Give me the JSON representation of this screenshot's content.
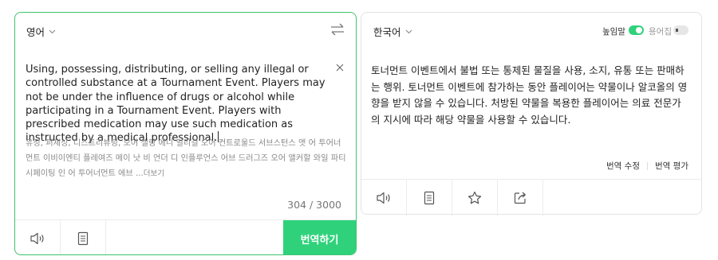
{
  "source": {
    "language": "영어",
    "text": "Using, possessing, distributing, or selling any illegal or controlled substance at a Tournament Event. Players may not be under the influence of drugs or alcohol while participating in a Tournament Event. Players with prescribed medication may use such medication as instructed by a medical professional.",
    "pronunciation": "유징, 퍼제싱, 디스트리뷰팅, 오어 셀링 에니 일리걸 오어 컨트로울드 서브스턴스 앳 어 투어너먼트 이비이엔티 플레여즈 메이 낫 비 언더 디 인플루언스 어브 드러그즈 오어 앨커할 와일 파티시페이팅 인 어 투어너먼트 에브 ...",
    "more_label": "더보기",
    "char_count": "304 / 3000",
    "translate_label": "번역하기"
  },
  "target": {
    "language": "한국어",
    "honorific_label": "높임말",
    "honorific_on": true,
    "glossary_label": "용어집",
    "glossary_on": false,
    "text": "토너먼트 이벤트에서 불법 또는 통제된 물질을 사용, 소지, 유통 또는 판매하는 행위. 토너먼트 이벤트에 참가하는 동안 플레이어는 약물이나 알코올의 영향을 받지 않을 수 있습니다. 처방된 약물을 복용한 플레이어는 의료 전문가의 지시에 따라 해당 약물을 사용할 수 있습니다.",
    "edit_label": "번역 수정",
    "rate_label": "번역 평가"
  },
  "icons": {
    "swap": "swap-icon",
    "clear": "close-icon",
    "speaker": "speaker-icon",
    "copy": "copy-icon",
    "star": "star-icon",
    "share": "share-icon"
  },
  "colors": {
    "accent": "#2fd27b",
    "active_border": "#3ec46d"
  }
}
